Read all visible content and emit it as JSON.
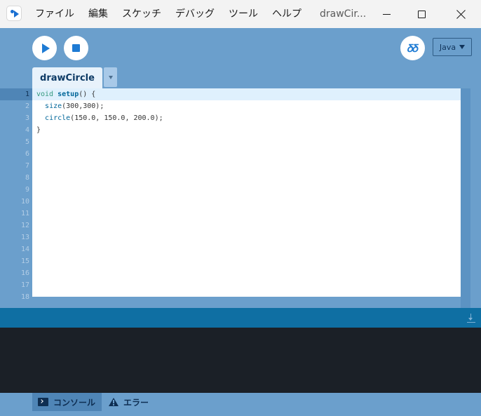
{
  "titlebar": {
    "app_icon": "processing-logo-icon",
    "menu": [
      "ファイル",
      "編集",
      "スケッチ",
      "デバッグ",
      "ツール",
      "ヘルプ"
    ],
    "window_title": "drawCir...",
    "controls": [
      "minimize-icon",
      "maximize-icon",
      "close-icon"
    ]
  },
  "toolbar": {
    "run_icon": "play-icon",
    "stop_icon": "stop-icon",
    "debug_icon": "debugger-icon",
    "debug_label": "𝛿𝛿",
    "mode": "Java"
  },
  "tabs": [
    {
      "label": "drawCircle",
      "active": true
    }
  ],
  "editor": {
    "current_line": 1,
    "line_numbers": [
      "1",
      "2",
      "3",
      "4",
      "5",
      "6",
      "7",
      "8",
      "9",
      "10",
      "11",
      "12",
      "13",
      "14",
      "15",
      "16",
      "17",
      "18"
    ],
    "code": [
      {
        "tokens": [
          {
            "t": "void",
            "c": "kw"
          },
          {
            "t": " "
          },
          {
            "t": "setup",
            "c": "fn"
          },
          {
            "t": "() {"
          }
        ]
      },
      {
        "tokens": [
          {
            "t": "  "
          },
          {
            "t": "size",
            "c": "fn2"
          },
          {
            "t": "(300,300);"
          }
        ]
      },
      {
        "tokens": [
          {
            "t": "  "
          },
          {
            "t": "circle",
            "c": "fn2"
          },
          {
            "t": "(150.0, 150.0, 200.0);"
          }
        ]
      },
      {
        "tokens": [
          {
            "t": "}"
          }
        ]
      }
    ]
  },
  "console": {
    "clear_icon": "clear-console-icon",
    "output": ""
  },
  "bottom_tabs": {
    "console": {
      "label": "コンソール",
      "icon": "terminal-icon",
      "active": true
    },
    "errors": {
      "label": "エラー",
      "icon": "warning-icon",
      "active": false
    }
  },
  "colors": {
    "toolbar_bg": "#6b9fcc",
    "accent_blue": "#1e7bd4",
    "console_header": "#0f6fa3",
    "console_bg": "#1b2027",
    "tab_bg": "#e8f2fb",
    "text_dark": "#0e2e52"
  }
}
